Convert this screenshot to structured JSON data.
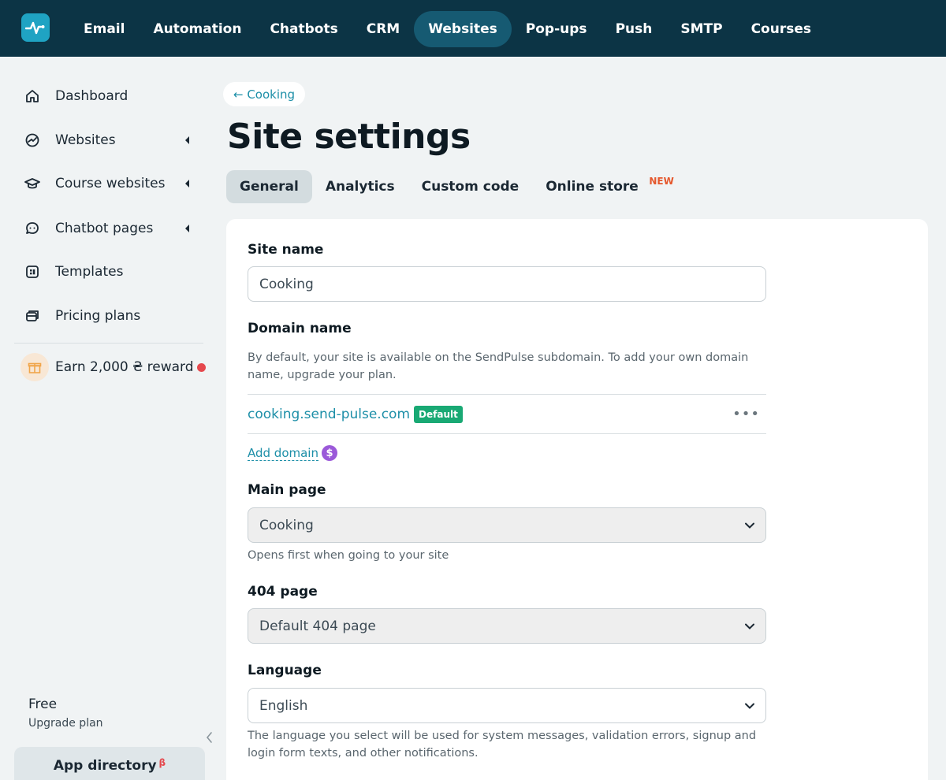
{
  "topnav": {
    "items": [
      {
        "label": "Email",
        "active": false
      },
      {
        "label": "Automation",
        "active": false
      },
      {
        "label": "Chatbots",
        "active": false
      },
      {
        "label": "CRM",
        "active": false
      },
      {
        "label": "Websites",
        "active": true
      },
      {
        "label": "Pop-ups",
        "active": false
      },
      {
        "label": "Push",
        "active": false
      },
      {
        "label": "SMTP",
        "active": false
      },
      {
        "label": "Courses",
        "active": false
      }
    ]
  },
  "sidebar": {
    "items": [
      {
        "label": "Dashboard",
        "icon": "home-icon"
      },
      {
        "label": "Websites",
        "icon": "globe-icon",
        "expandable": true
      },
      {
        "label": "Course websites",
        "icon": "graduation-cap-icon",
        "expandable": true
      },
      {
        "label": "Chatbot pages",
        "icon": "chat-icon",
        "expandable": true
      },
      {
        "label": "Templates",
        "icon": "templates-icon"
      },
      {
        "label": "Pricing plans",
        "icon": "pricing-icon"
      }
    ],
    "reward": "Earn 2,000 ₴ reward",
    "plan": {
      "name": "Free",
      "upgrade": "Upgrade plan"
    },
    "app_directory": {
      "label": "App directory",
      "beta": "β"
    }
  },
  "breadcrumb": {
    "back": "← Cooking"
  },
  "page": {
    "title": "Site settings"
  },
  "tabs": [
    {
      "label": "General",
      "active": true
    },
    {
      "label": "Analytics",
      "active": false
    },
    {
      "label": "Custom code",
      "active": false
    },
    {
      "label": "Online store",
      "active": false,
      "badge": "NEW"
    }
  ],
  "form": {
    "site_name": {
      "label": "Site name",
      "value": "Cooking"
    },
    "domain": {
      "label": "Domain name",
      "help": "By default, your site is available on the SendPulse subdomain. To add your own domain name, upgrade your plan.",
      "current": "cooking.send-pulse.com",
      "badge": "Default",
      "more": "•••",
      "add_label": "Add domain",
      "add_coin": "$"
    },
    "main_page": {
      "label": "Main page",
      "value": "Cooking",
      "help": "Opens first when going to your site"
    },
    "page_404": {
      "label": "404 page",
      "value": "Default 404 page"
    },
    "language": {
      "label": "Language",
      "value": "English",
      "help": "The language you select will be used for system messages, validation errors, signup and login form texts, and other notifications."
    }
  },
  "colors": {
    "topbar": "#0c3445",
    "accent": "#1d8fa8",
    "active_nav": "#165a72",
    "badge_green": "#19a974",
    "alert_red": "#e5484d"
  }
}
